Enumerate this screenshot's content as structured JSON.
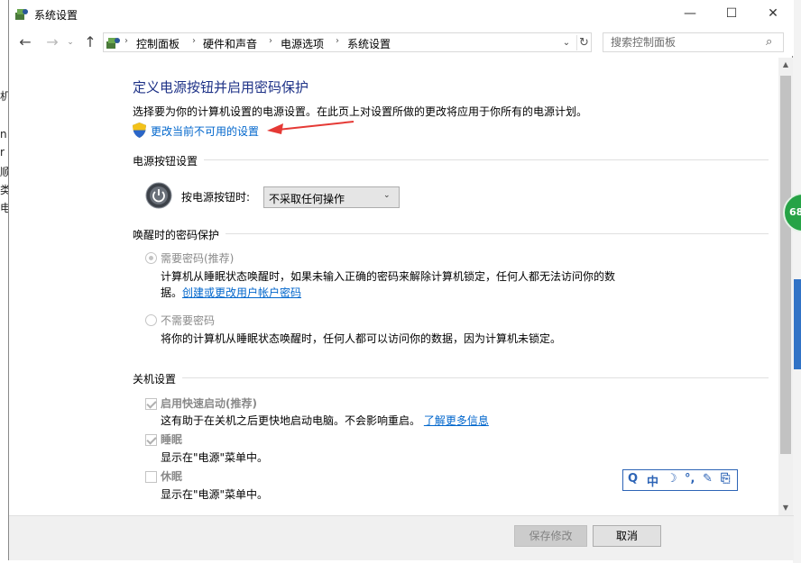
{
  "window": {
    "title": "系统设置",
    "minimize_glyph": "—",
    "maximize_glyph": "☐",
    "close_glyph": "✕"
  },
  "nav": {
    "back_glyph": "←",
    "forward_glyph": "→",
    "dropdown_glyph": "⌄",
    "up_glyph": "↑"
  },
  "address": {
    "crumbs": [
      "控制面板",
      "硬件和声音",
      "电源选项",
      "系统设置"
    ],
    "separator": "›",
    "dropdown_glyph": "⌄",
    "refresh_glyph": "↻"
  },
  "search": {
    "placeholder": "搜索控制面板",
    "icon": "search-icon",
    "glyph": "⌕"
  },
  "content": {
    "title": "定义电源按钮并启用密码保护",
    "description": "选择要为你的计算机设置的电源设置。在此页上对设置所做的更改将应用于你所有的电源计划。",
    "change_link": "更改当前不可用的设置"
  },
  "power_section": {
    "heading": "电源按钮设置",
    "label": "按电源按钮时:",
    "selected": "不采取任何操作",
    "dropdown_glyph": "⌄"
  },
  "password_section": {
    "heading": "唤醒时的密码保护",
    "require_label": "需要密码(推荐)",
    "require_desc_line1": "计算机从睡眠状态唤醒时，如果未输入正确的密码来解除计算机锁定，任何人都无法访问你的数",
    "require_desc_line2_prefix": "据。",
    "require_link": "创建或更改用户帐户密码",
    "no_require_label": "不需要密码",
    "no_require_desc": "将你的计算机从睡眠状态唤醒时，任何人都可以访问你的数据，因为计算机未锁定。"
  },
  "shutdown_section": {
    "heading": "关机设置",
    "fast_startup_label": "启用快速启动(推荐)",
    "fast_startup_desc": "这有助于在关机之后更快地启动电脑。不会影响重启。",
    "learn_more": "了解更多信息",
    "sleep_label": "睡眠",
    "sleep_desc": "显示在\"电源\"菜单中。",
    "hibernate_label": "休眠",
    "hibernate_desc": "显示在\"电源\"菜单中。"
  },
  "footer": {
    "save_label": "保存修改",
    "cancel_label": "取消"
  },
  "ime_toolbar": {
    "items": [
      "Q",
      "中",
      "☽",
      "°,",
      "✎",
      "⎘"
    ]
  },
  "background": {
    "left_fragments": [
      "机",
      "n1",
      "r",
      "顺",
      "类",
      "电"
    ],
    "badge_text": "68"
  },
  "colors": {
    "title_blue": "#1e3287",
    "link_blue": "#0066cc",
    "ime_blue": "#2d64b6",
    "badge_green": "#26a346"
  }
}
